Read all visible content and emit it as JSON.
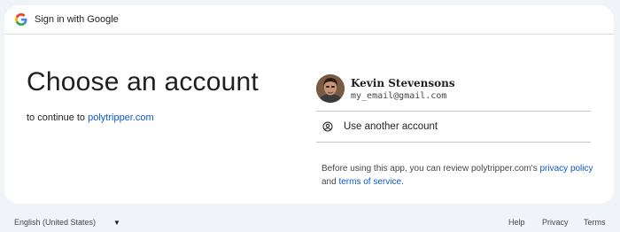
{
  "header": {
    "title": "Sign in with Google",
    "logo_icon": "google-g-icon"
  },
  "main": {
    "title": "Choose an account",
    "subtitle_prefix": "to continue to ",
    "app_link": "polytripper.com"
  },
  "account": {
    "name": "Kevin Stevensons",
    "email": "my_email@gmail.com"
  },
  "use_another": {
    "label": "Use another account",
    "icon": "person-circle-icon"
  },
  "notice": {
    "text_prefix": "Before using this app, you can review polytripper.com's ",
    "privacy_link": "privacy policy",
    "text_mid": " and ",
    "terms_link": "terms of service",
    "text_suffix": "."
  },
  "footer": {
    "language": "English (United States)",
    "caret_icon": "caret-down-icon",
    "help": "Help",
    "privacy": "Privacy",
    "terms": "Terms"
  },
  "colors": {
    "background": "#f0f4f9",
    "card": "#ffffff",
    "link": "#0b57d0"
  }
}
